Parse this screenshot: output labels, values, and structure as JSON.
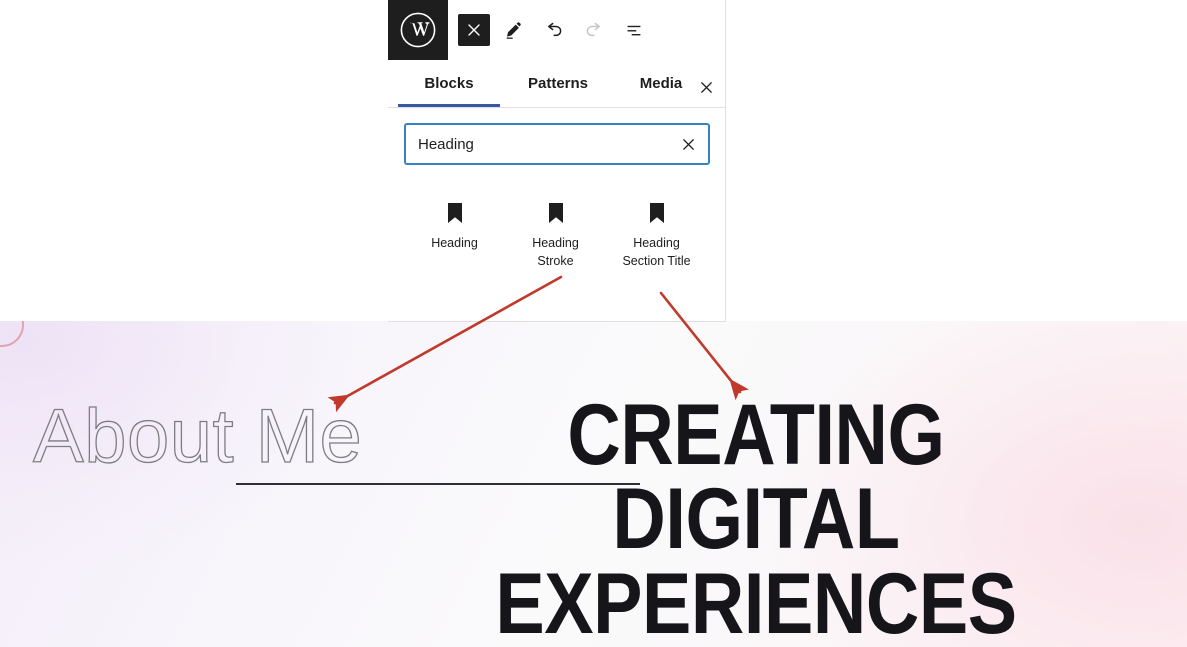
{
  "editor": {
    "toolbar": {
      "logo_label": "WordPress",
      "logo_icon": "wordpress-logo-icon",
      "buttons": [
        {
          "name": "toggle-block-inserter",
          "icon": "close-x-icon",
          "label": "Close block inserter",
          "state": "active"
        },
        {
          "name": "tools-edit",
          "icon": "pencil-icon",
          "label": "Edit",
          "state": "default"
        },
        {
          "name": "undo",
          "icon": "undo-arrow-icon",
          "label": "Undo",
          "state": "default"
        },
        {
          "name": "redo",
          "icon": "redo-arrow-icon",
          "label": "Redo",
          "state": "disabled"
        },
        {
          "name": "list-view",
          "icon": "list-view-icon",
          "label": "Document Overview",
          "state": "default"
        }
      ]
    },
    "inserter": {
      "tabs": [
        {
          "label": "Blocks",
          "selected": true
        },
        {
          "label": "Patterns",
          "selected": false
        },
        {
          "label": "Media",
          "selected": false
        }
      ],
      "close_label": "Close",
      "close_icon": "close-x-icon",
      "search": {
        "value": "Heading",
        "placeholder": "Search",
        "clear_label": "Reset search",
        "clear_icon": "close-x-icon"
      },
      "results": [
        {
          "label": "Heading",
          "icon": "heading-bookmark-icon"
        },
        {
          "label": "Heading\nStroke",
          "icon": "heading-bookmark-icon"
        },
        {
          "label": "Heading\nSection Title",
          "icon": "heading-bookmark-icon"
        }
      ]
    },
    "canvas": {
      "stroke_heading": "About Me",
      "section_title": "CREATING DIGITAL\nEXPERIENCES"
    },
    "annotations": [
      {
        "name": "arrow-to-heading-stroke",
        "color": "#c0392b",
        "from": "Heading Stroke",
        "to": "About Me"
      },
      {
        "name": "arrow-to-section-title",
        "color": "#c0392b",
        "from": "Heading Section Title",
        "to": "CREATING DIGITAL EXPERIENCES"
      }
    ]
  },
  "colors": {
    "accent_blue": "#3858a5",
    "focus_blue": "#3582c4",
    "ink": "#1e1e1e",
    "annotation_red": "#c0392b",
    "toolbar_dark": "#1e1e1e"
  }
}
